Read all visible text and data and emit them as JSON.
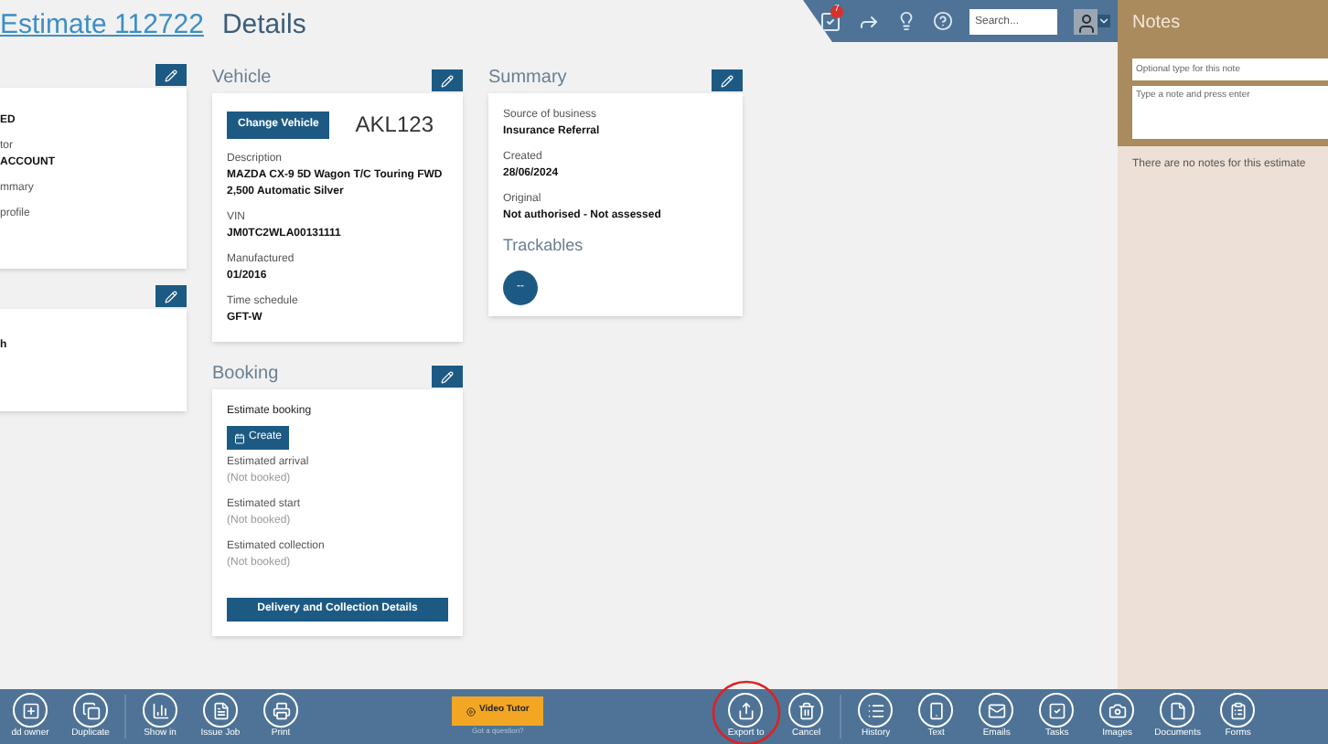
{
  "header": {
    "title_link": "Estimate 112722",
    "title": "Details",
    "tasks_badge": "7",
    "search": {
      "placeholder": "Search..."
    }
  },
  "left_cards": [
    {
      "fields": [
        {
          "value": "ED"
        },
        {
          "label": "tor",
          "value": "ACCOUNT"
        },
        {
          "label": "mmary"
        },
        {
          "label": "profile"
        }
      ]
    },
    {
      "fields": [
        {
          "value": "h"
        }
      ]
    }
  ],
  "vehicle": {
    "title": "Vehicle",
    "change_button": "Change Vehicle",
    "plate": "AKL123",
    "fields": [
      {
        "label": "Description",
        "value": "MAZDA CX-9 5D Wagon T/C Touring FWD 2,500 Automatic Silver"
      },
      {
        "label": "VIN",
        "value": "JM0TC2WLA00131111"
      },
      {
        "label": "Manufactured",
        "value": "01/2016"
      },
      {
        "label": "Time schedule",
        "value": "GFT-W"
      }
    ]
  },
  "booking": {
    "title": "Booking",
    "estimate_label": "Estimate booking",
    "create_button": "Create",
    "fields": [
      {
        "label": "Estimated arrival",
        "value": "(Not booked)"
      },
      {
        "label": "Estimated start",
        "value": "(Not booked)"
      },
      {
        "label": "Estimated collection",
        "value": "(Not booked)"
      }
    ],
    "details_button": "Delivery and Collection Details"
  },
  "summary": {
    "title": "Summary",
    "fields": [
      {
        "label": "Source of business",
        "value": "Insurance Referral"
      },
      {
        "label": "Created",
        "value": "28/06/2024"
      },
      {
        "label": "Original",
        "value": "Not authorised - Not assessed"
      }
    ],
    "trackables_title": "Trackables",
    "trackables_button": "--"
  },
  "notes": {
    "title": "Notes",
    "type_field": {
      "placeholder": "Optional type for this note"
    },
    "note_field": {
      "placeholder": "Type a note and press enter"
    },
    "empty": "There are no notes for this estimate"
  },
  "toolbar": {
    "left": [
      {
        "kind": "add",
        "label": "dd owner"
      },
      {
        "kind": "duplicate",
        "label": "Duplicate"
      },
      {
        "kind": "chart",
        "label": "Show in"
      },
      {
        "kind": "job",
        "label": "Issue Job"
      },
      {
        "kind": "print",
        "label": "Print"
      }
    ],
    "video_button": "Video Tutor",
    "question_link": "Got a question?",
    "right": [
      {
        "kind": "export",
        "label": "Export to",
        "circled": true
      },
      {
        "kind": "trash",
        "label": "Cancel",
        "circled": false
      },
      {
        "kind": "history",
        "label": "History",
        "circled": false
      },
      {
        "kind": "phone",
        "label": "Text",
        "circled": false
      },
      {
        "kind": "mail",
        "label": "Emails",
        "circled": false
      },
      {
        "kind": "tasks",
        "label": "Tasks",
        "circled": false
      },
      {
        "kind": "camera",
        "label": "Images",
        "circled": false
      },
      {
        "kind": "file",
        "label": "Documents",
        "circled": false
      },
      {
        "kind": "form",
        "label": "Forms",
        "circled": false
      }
    ]
  }
}
